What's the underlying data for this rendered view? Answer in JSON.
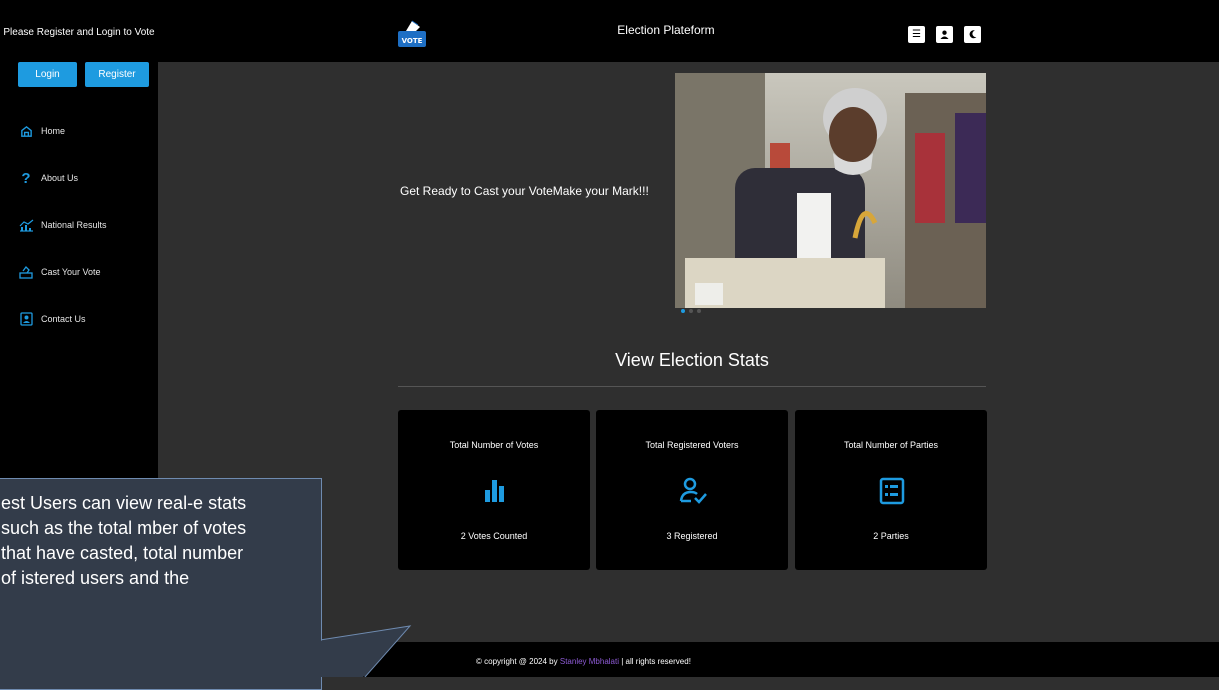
{
  "sidebar": {
    "prompt": "Please Register and Login to Vote",
    "login_label": "Login",
    "register_label": "Register",
    "nav": [
      {
        "label": "Home",
        "icon": "home-icon"
      },
      {
        "label": "About Us",
        "icon": "question-icon"
      },
      {
        "label": "National Results",
        "icon": "chart-line-icon"
      },
      {
        "label": "Cast Your Vote",
        "icon": "ballot-icon"
      },
      {
        "label": "Contact Us",
        "icon": "contact-card-icon"
      }
    ]
  },
  "header": {
    "logo_text": "VOTE",
    "title": "Election Plateform",
    "buttons": [
      "menu-icon",
      "user-icon",
      "moon-icon"
    ]
  },
  "hero": {
    "tagline": "Get Ready to Cast your VoteMake your Mark!!!",
    "slide_count": 3,
    "active_slide": 1
  },
  "stats": {
    "title": "View Election Stats",
    "cards": [
      {
        "label": "Total Number of Votes",
        "value": "2 Votes Counted",
        "icon": "bar-chart-icon"
      },
      {
        "label": "Total Registered Voters",
        "value": "3 Registered",
        "icon": "user-check-icon"
      },
      {
        "label": "Total Number of Parties",
        "value": "2 Parties",
        "icon": "list-icon"
      }
    ]
  },
  "footer": {
    "prefix": "© copyright @ 2024 by",
    "author": "Stanley Mbhalati",
    "suffix": "| all rights reserved!"
  },
  "callout": {
    "text": "est Users can view real-e stats such as the total mber of votes that have casted, total number of istered users and the"
  },
  "colors": {
    "accent": "#1e9be0",
    "author": "#8e5bd6",
    "callout_bg": "#333c4a"
  }
}
